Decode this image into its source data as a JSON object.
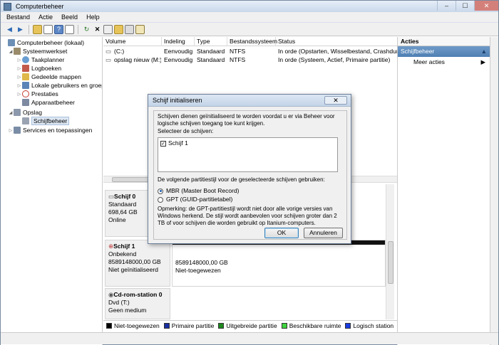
{
  "window": {
    "title": "Computerbeheer",
    "minimize": "–",
    "maximize": "☐",
    "close": "✕"
  },
  "menu": [
    "Bestand",
    "Actie",
    "Beeld",
    "Help"
  ],
  "tree": [
    {
      "label": "Computerbeheer (lokaal)",
      "level": 0,
      "toggle": "",
      "icon": "computer-icon",
      "color": "#6d8fb5"
    },
    {
      "label": "Systeemwerkset",
      "level": 1,
      "toggle": "◢",
      "icon": "tools-icon",
      "color": "#9a8c6b"
    },
    {
      "label": "Taakplanner",
      "level": 2,
      "toggle": "▷",
      "icon": "clock-icon",
      "color": "#6a9ed2"
    },
    {
      "label": "Logboeken",
      "level": 2,
      "toggle": "▷",
      "icon": "log-icon",
      "color": "#c25a4c"
    },
    {
      "label": "Gedeelde mappen",
      "level": 2,
      "toggle": "▷",
      "icon": "folder-icon",
      "color": "#e0b84a"
    },
    {
      "label": "Lokale gebruikers en groepen",
      "level": 2,
      "toggle": "▷",
      "icon": "users-icon",
      "color": "#5b84b8"
    },
    {
      "label": "Prestaties",
      "level": 2,
      "toggle": "▷",
      "icon": "performance-icon",
      "color": "#c33a2e"
    },
    {
      "label": "Apparaatbeheer",
      "level": 2,
      "toggle": "",
      "icon": "device-icon",
      "color": "#7d8aa0"
    },
    {
      "label": "Opslag",
      "level": 1,
      "toggle": "◢",
      "icon": "storage-icon",
      "color": "#8c98ab"
    },
    {
      "label": "Schijfbeheer",
      "level": 2,
      "toggle": "",
      "icon": "disk-icon",
      "color": "#9aa3b2",
      "selected": true
    },
    {
      "label": "Services en toepassingen",
      "level": 1,
      "toggle": "▷",
      "icon": "services-icon",
      "color": "#7b8da6"
    }
  ],
  "list": {
    "columns": [
      "Volume",
      "Indeling",
      "Type",
      "Bestandssysteem",
      "Status"
    ],
    "rows": [
      [
        "(C:)",
        "Eenvoudig",
        "Standaard",
        "NTFS",
        "In orde (Opstarten, Wisselbestand, Crashdump, Primaire partitie)"
      ],
      [
        "opslag nieuw (M:)",
        "Eenvoudig",
        "Standaard",
        "NTFS",
        "In orde (Systeem, Actief, Primaire partitie)"
      ]
    ]
  },
  "disks": [
    {
      "name": "Schijf 0",
      "lines": [
        "Standaard",
        "698,64 GB",
        "Online"
      ],
      "part_lines": []
    },
    {
      "name": "Schijf 1",
      "lines": [
        "Onbekend",
        "8589148000,00 GB",
        "Niet geïnitialiseerd"
      ],
      "part_lines": [
        "8589148000,00 GB",
        "Niet-toegewezen"
      ]
    },
    {
      "name": "Cd-rom-station 0",
      "lines": [
        "Dvd (T:)",
        "",
        "Geen medium"
      ],
      "part_lines": []
    }
  ],
  "legend": [
    {
      "label": "Niet-toegewezen",
      "color": "#000000"
    },
    {
      "label": "Primaire partitie",
      "color": "#1a2fa0"
    },
    {
      "label": "Uitgebreide partitie",
      "color": "#1f8a1f"
    },
    {
      "label": "Beschikbare ruimte",
      "color": "#3fd43f"
    },
    {
      "label": "Logisch station",
      "color": "#1a3ce0"
    }
  ],
  "actions": {
    "header": "Acties",
    "section": "Schijfbeheer",
    "section_arrow": "▲",
    "more": "Meer acties",
    "more_arrow": "▶"
  },
  "dialog": {
    "title": "Schijf initialiseren",
    "close": "✕",
    "intro": "Schijven dienen geïnitialiseerd te worden voordat u er via Beheer voor logische schijven toegang toe kunt krijgen.",
    "select_label": "Selecteer de schijven:",
    "disk_item": "Schijf 1",
    "disk_checked": "✓",
    "style_label": "De volgende partitiestijl voor de geselecteerde schijven gebruiken:",
    "option_mbr": "MBR (Master Boot Record)",
    "option_gpt": "GPT (GUID-partitietabel)",
    "note": "Opmerking: de GPT-partitiestijl wordt niet door alle vorige versies van Windows herkend. De stijl wordt aanbevolen voor schijven groter dan 2 TB of voor schijven die worden gebruikt op Itanium-computers.",
    "ok": "OK",
    "cancel": "Annuleren"
  }
}
